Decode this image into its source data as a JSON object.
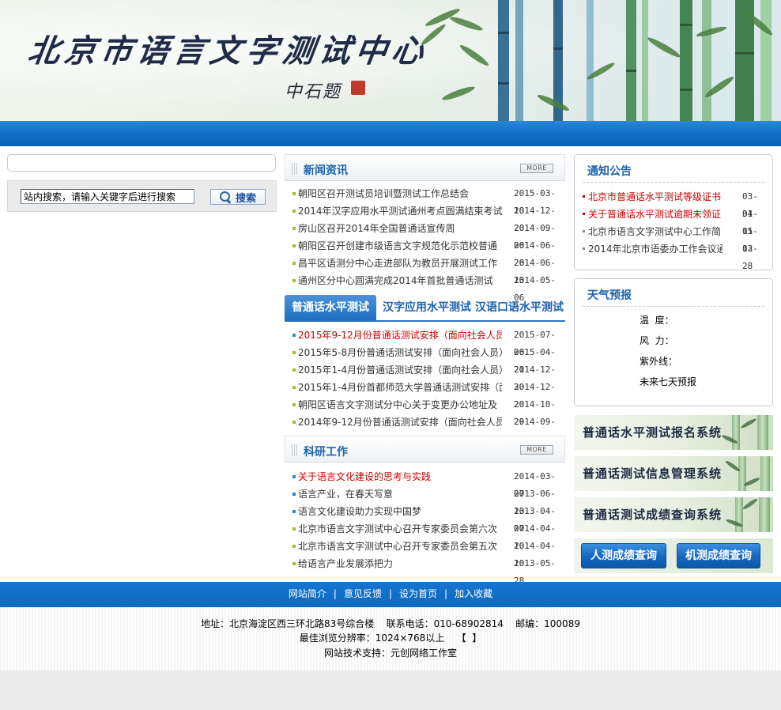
{
  "banner": {
    "site_title": "北京市语言文字测试中心",
    "signature": "中石题"
  },
  "search": {
    "placeholder": "站内搜索，请输入关键字后进行搜索",
    "button_label": "搜索",
    "button_icon": "search-icon"
  },
  "news": {
    "title": "新闻资讯",
    "more_label": "MORE",
    "items": [
      {
        "text": "朝阳区召开测试员培训暨测试工作总结会",
        "date": "2015-03-10"
      },
      {
        "text": "2014年汉字应用水平测试通州考点圆满结束考试",
        "date": "2014-12-20"
      },
      {
        "text": "房山区召开2014年全国普通话宣传周",
        "date": "2014-09-06"
      },
      {
        "text": "朝阳区召开创建市级语言文字规范化示范校普通",
        "date": "2014-06-26"
      },
      {
        "text": "昌平区语测分中心走进部队为教员开展测试工作",
        "date": "2014-06-13"
      },
      {
        "text": "通州区分中心圆满完成2014年首批普通话测试",
        "date": "2014-05-06"
      }
    ]
  },
  "tabs": {
    "items": [
      "普通话水平测试",
      "汉字应用水平测试",
      "汉语口语水平测试"
    ],
    "active": "普通话水平测试",
    "list": [
      {
        "text": "2015年9-12月份普通话测试安排（面向社会人员",
        "date": "2015-07-06",
        "hot": true
      },
      {
        "text": "2015年5-8月份普通话测试安排（面向社会人员）",
        "date": "2015-04-21",
        "hot": false
      },
      {
        "text": "2015年1-4月份普通话测试安排（面向社会人员）",
        "date": "2014-12-30",
        "hot": false
      },
      {
        "text": "2015年1-4月份首都师范大学普通话测试安排（面",
        "date": "2014-12-20",
        "hot": false
      },
      {
        "text": "朝阳区语言文字测试分中心关于变更办公地址及",
        "date": "2014-10-29",
        "hot": false
      },
      {
        "text": "2014年9-12月份普通话测试安排（面向社会人员",
        "date": "2014-09-19",
        "hot": false
      }
    ]
  },
  "research": {
    "title": "科研工作",
    "more_label": "MORE",
    "items": [
      {
        "text": "关于语言文化建设的思考与实践",
        "date": "2014-03-07",
        "hot": true
      },
      {
        "text": "语言产业，在春天写意",
        "date": "2013-06-13",
        "hot": false
      },
      {
        "text": "语言文化建设助力实现中国梦",
        "date": "2013-04-07",
        "hot": false
      },
      {
        "text": "北京市语言文字测试中心召开专家委员会第六次",
        "date": "2014-04-10",
        "hot": false
      },
      {
        "text": "北京市语言文字测试中心召开专家委员会第五次",
        "date": "2014-04-10",
        "hot": false
      },
      {
        "text": "给语言产业发展添把力",
        "date": "2013-05-28",
        "hot": false
      }
    ]
  },
  "notice": {
    "title": "通知公告",
    "items": [
      {
        "text": "北京市普通话水平测试等级证书",
        "date": "03-31",
        "hot": true
      },
      {
        "text": "关于普通话水平测试逾期未领证",
        "date": "04-15",
        "hot": true
      },
      {
        "text": "北京市语言文字测试中心工作简",
        "date": "01-13",
        "hot": false
      },
      {
        "text": "2014年北京市语委办工作会议通",
        "date": "02-28",
        "hot": false
      }
    ]
  },
  "weather": {
    "title": "天气预报",
    "temperature_label": "温  度：",
    "wind_label": "风  力：",
    "uv_label": "紫外线：",
    "forecast_label": "未来七天预报"
  },
  "systems": [
    {
      "label": "普通话水平测试报名系统"
    },
    {
      "label": "普通话测试信息管理系统"
    },
    {
      "label": "普通话测试成绩查询系统"
    }
  ],
  "query": {
    "manual_label": "人测成绩查询",
    "machine_label": "机测成绩查询"
  },
  "footer": {
    "links": [
      "网站简介",
      "意见反馈",
      "设为首页",
      "加入收藏"
    ],
    "separator": "|",
    "address": "地址：北京海淀区西三环北路83号综合楼",
    "phone": "联系电话：010-68902814",
    "postcode": "邮编：100089",
    "resolution": "最佳浏览分辨率：1024×768以上",
    "bracket": "【  】",
    "support": "网站技术支持：元创网络工作室"
  },
  "colors": {
    "brand_blue": "#0f6fc6",
    "title_blue": "#1d63b0",
    "hot_red": "#cc0000"
  }
}
